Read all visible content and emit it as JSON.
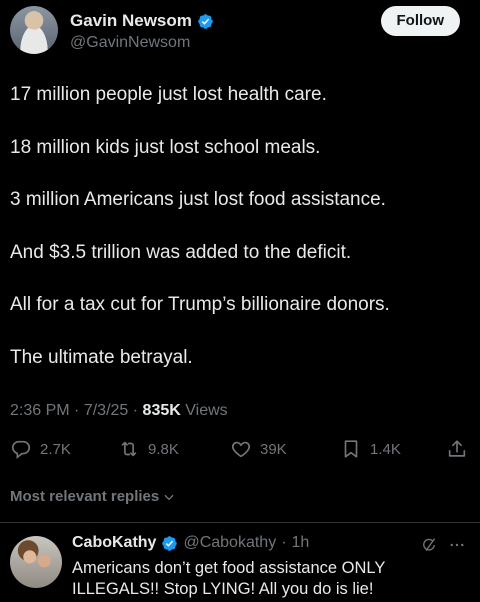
{
  "author": {
    "display_name": "Gavin Newsom",
    "handle": "@GavinNewsom",
    "verified": true
  },
  "follow_label": "Follow",
  "post": {
    "lines": [
      "17 million people just lost health care.",
      "18 million kids just lost school meals.",
      "3 million Americans just lost food assistance.",
      "And $3.5 trillion was added to the deficit.",
      "All for a tax cut for Trump’s billionaire donors.",
      "The ultimate betrayal."
    ],
    "time": "2:36 PM",
    "date": "7/3/25",
    "views_count": "835K",
    "views_label": "Views"
  },
  "actions": {
    "replies": "2.7K",
    "reposts": "9.8K",
    "likes": "39K",
    "bookmarks": "1.4K"
  },
  "sort_label": "Most relevant replies",
  "reply": {
    "display_name": "CaboKathy",
    "handle": "@Cabokathy",
    "age": "1h",
    "text": "Americans don’t get food assistance ONLY ILLEGALS!! Stop LYING! All you do is lie!"
  },
  "colors": {
    "background": "#000000",
    "text": "#e7e9ea",
    "secondary": "#71767b",
    "verified": "#1d9bf0"
  }
}
